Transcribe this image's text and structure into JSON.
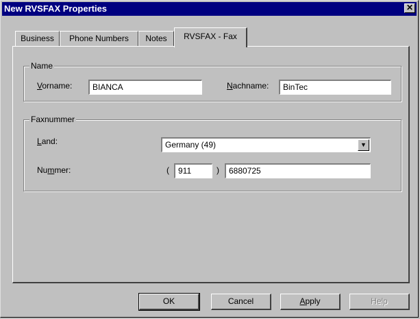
{
  "window": {
    "title": "New RVSFAX Properties",
    "close_glyph": "✕"
  },
  "tabs": [
    {
      "label": "Business"
    },
    {
      "label": "Phone Numbers"
    },
    {
      "label": "Notes"
    },
    {
      "label": "RVSFAX - Fax",
      "active": true
    }
  ],
  "name_group": {
    "legend": "Name",
    "vorname_label_u": "V",
    "vorname_label_rest": "orname:",
    "vorname_value": "BIANCA",
    "nachname_label_u": "N",
    "nachname_label_rest": "achname:",
    "nachname_value": "BinTec"
  },
  "fax_group": {
    "legend": "Faxnummer",
    "land_label_u": "L",
    "land_label_rest": "and:",
    "land_value": "Germany (49)",
    "nummer_label_pre": "Nu",
    "nummer_label_u": "m",
    "nummer_label_rest": "mer:",
    "open_paren": "(",
    "area_code": "911",
    "close_paren": ")",
    "number": "6880725"
  },
  "buttons": {
    "ok": "OK",
    "cancel": "Cancel",
    "apply_u": "A",
    "apply_rest": "pply",
    "help": "Help"
  }
}
